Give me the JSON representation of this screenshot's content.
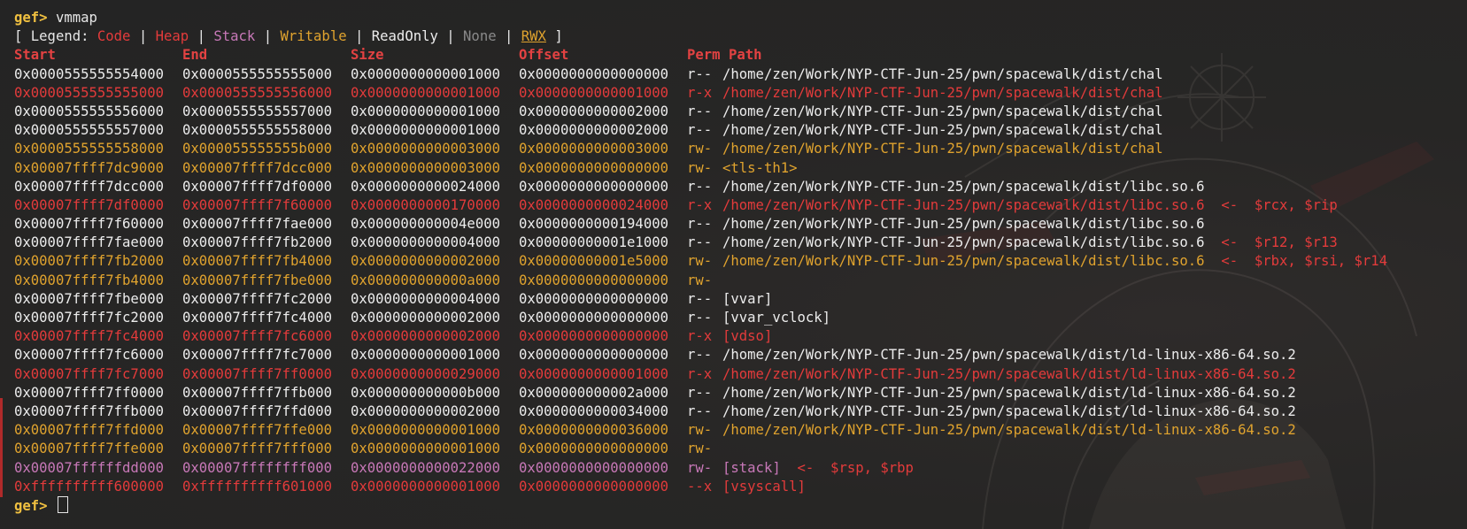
{
  "prompt": "gef>",
  "command": "vmmap",
  "legend": {
    "open": "[ Legend:",
    "close": "]",
    "separator": "|",
    "items": [
      {
        "label": "Code",
        "kind": "code"
      },
      {
        "label": "Heap",
        "kind": "heap"
      },
      {
        "label": "Stack",
        "kind": "stack"
      },
      {
        "label": "Writable",
        "kind": "write"
      },
      {
        "label": "ReadOnly",
        "kind": "ro"
      },
      {
        "label": "None",
        "kind": "none"
      },
      {
        "label": "RWX",
        "kind": "rwx"
      }
    ]
  },
  "columns": {
    "start": "Start",
    "end": "End",
    "size": "Size",
    "offset": "Offset",
    "perm_path": "Perm Path"
  },
  "rows": [
    {
      "start": "0x0000555555554000",
      "end": "0x0000555555555000",
      "size": "0x0000000000001000",
      "offset": "0x0000000000000000",
      "perm": "r--",
      "path": "/home/zen/Work/NYP-CTF-Jun-25/pwn/spacewalk/dist/chal",
      "regs": "",
      "kind": "ro"
    },
    {
      "start": "0x0000555555555000",
      "end": "0x0000555555556000",
      "size": "0x0000000000001000",
      "offset": "0x0000000000001000",
      "perm": "r-x",
      "path": "/home/zen/Work/NYP-CTF-Jun-25/pwn/spacewalk/dist/chal",
      "regs": "",
      "kind": "code"
    },
    {
      "start": "0x0000555555556000",
      "end": "0x0000555555557000",
      "size": "0x0000000000001000",
      "offset": "0x0000000000002000",
      "perm": "r--",
      "path": "/home/zen/Work/NYP-CTF-Jun-25/pwn/spacewalk/dist/chal",
      "regs": "",
      "kind": "ro"
    },
    {
      "start": "0x0000555555557000",
      "end": "0x0000555555558000",
      "size": "0x0000000000001000",
      "offset": "0x0000000000002000",
      "perm": "r--",
      "path": "/home/zen/Work/NYP-CTF-Jun-25/pwn/spacewalk/dist/chal",
      "regs": "",
      "kind": "ro"
    },
    {
      "start": "0x0000555555558000",
      "end": "0x000055555555b000",
      "size": "0x0000000000003000",
      "offset": "0x0000000000003000",
      "perm": "rw-",
      "path": "/home/zen/Work/NYP-CTF-Jun-25/pwn/spacewalk/dist/chal",
      "regs": "",
      "kind": "write"
    },
    {
      "start": "0x00007ffff7dc9000",
      "end": "0x00007ffff7dcc000",
      "size": "0x0000000000003000",
      "offset": "0x0000000000000000",
      "perm": "rw-",
      "path": "<tls-th1>",
      "regs": "",
      "kind": "write"
    },
    {
      "start": "0x00007ffff7dcc000",
      "end": "0x00007ffff7df0000",
      "size": "0x0000000000024000",
      "offset": "0x0000000000000000",
      "perm": "r--",
      "path": "/home/zen/Work/NYP-CTF-Jun-25/pwn/spacewalk/dist/libc.so.6",
      "regs": "",
      "kind": "ro"
    },
    {
      "start": "0x00007ffff7df0000",
      "end": "0x00007ffff7f60000",
      "size": "0x0000000000170000",
      "offset": "0x0000000000024000",
      "perm": "r-x",
      "path": "/home/zen/Work/NYP-CTF-Jun-25/pwn/spacewalk/dist/libc.so.6",
      "regs": "<-  $rcx, $rip",
      "kind": "code"
    },
    {
      "start": "0x00007ffff7f60000",
      "end": "0x00007ffff7fae000",
      "size": "0x000000000004e000",
      "offset": "0x0000000000194000",
      "perm": "r--",
      "path": "/home/zen/Work/NYP-CTF-Jun-25/pwn/spacewalk/dist/libc.so.6",
      "regs": "",
      "kind": "ro"
    },
    {
      "start": "0x00007ffff7fae000",
      "end": "0x00007ffff7fb2000",
      "size": "0x0000000000004000",
      "offset": "0x00000000001e1000",
      "perm": "r--",
      "path": "/home/zen/Work/NYP-CTF-Jun-25/pwn/spacewalk/dist/libc.so.6",
      "regs": "<-  $r12, $r13",
      "kind": "ro"
    },
    {
      "start": "0x00007ffff7fb2000",
      "end": "0x00007ffff7fb4000",
      "size": "0x0000000000002000",
      "offset": "0x00000000001e5000",
      "perm": "rw-",
      "path": "/home/zen/Work/NYP-CTF-Jun-25/pwn/spacewalk/dist/libc.so.6",
      "regs": "<-  $rbx, $rsi, $r14",
      "kind": "write"
    },
    {
      "start": "0x00007ffff7fb4000",
      "end": "0x00007ffff7fbe000",
      "size": "0x000000000000a000",
      "offset": "0x0000000000000000",
      "perm": "rw-",
      "path": "",
      "regs": "",
      "kind": "write"
    },
    {
      "start": "0x00007ffff7fbe000",
      "end": "0x00007ffff7fc2000",
      "size": "0x0000000000004000",
      "offset": "0x0000000000000000",
      "perm": "r--",
      "path": "[vvar]",
      "regs": "",
      "kind": "ro"
    },
    {
      "start": "0x00007ffff7fc2000",
      "end": "0x00007ffff7fc4000",
      "size": "0x0000000000002000",
      "offset": "0x0000000000000000",
      "perm": "r--",
      "path": "[vvar_vclock]",
      "regs": "",
      "kind": "ro"
    },
    {
      "start": "0x00007ffff7fc4000",
      "end": "0x00007ffff7fc6000",
      "size": "0x0000000000002000",
      "offset": "0x0000000000000000",
      "perm": "r-x",
      "path": "[vdso]",
      "regs": "",
      "kind": "code"
    },
    {
      "start": "0x00007ffff7fc6000",
      "end": "0x00007ffff7fc7000",
      "size": "0x0000000000001000",
      "offset": "0x0000000000000000",
      "perm": "r--",
      "path": "/home/zen/Work/NYP-CTF-Jun-25/pwn/spacewalk/dist/ld-linux-x86-64.so.2",
      "regs": "",
      "kind": "ro"
    },
    {
      "start": "0x00007ffff7fc7000",
      "end": "0x00007ffff7ff0000",
      "size": "0x0000000000029000",
      "offset": "0x0000000000001000",
      "perm": "r-x",
      "path": "/home/zen/Work/NYP-CTF-Jun-25/pwn/spacewalk/dist/ld-linux-x86-64.so.2",
      "regs": "",
      "kind": "code"
    },
    {
      "start": "0x00007ffff7ff0000",
      "end": "0x00007ffff7ffb000",
      "size": "0x000000000000b000",
      "offset": "0x000000000002a000",
      "perm": "r--",
      "path": "/home/zen/Work/NYP-CTF-Jun-25/pwn/spacewalk/dist/ld-linux-x86-64.so.2",
      "regs": "",
      "kind": "ro"
    },
    {
      "start": "0x00007ffff7ffb000",
      "end": "0x00007ffff7ffd000",
      "size": "0x0000000000002000",
      "offset": "0x0000000000034000",
      "perm": "r--",
      "path": "/home/zen/Work/NYP-CTF-Jun-25/pwn/spacewalk/dist/ld-linux-x86-64.so.2",
      "regs": "",
      "kind": "ro"
    },
    {
      "start": "0x00007ffff7ffd000",
      "end": "0x00007ffff7ffe000",
      "size": "0x0000000000001000",
      "offset": "0x0000000000036000",
      "perm": "rw-",
      "path": "/home/zen/Work/NYP-CTF-Jun-25/pwn/spacewalk/dist/ld-linux-x86-64.so.2",
      "regs": "",
      "kind": "write"
    },
    {
      "start": "0x00007ffff7ffe000",
      "end": "0x00007ffff7fff000",
      "size": "0x0000000000001000",
      "offset": "0x0000000000000000",
      "perm": "rw-",
      "path": "",
      "regs": "",
      "kind": "write"
    },
    {
      "start": "0x00007ffffffdd000",
      "end": "0x00007ffffffff000",
      "size": "0x0000000000022000",
      "offset": "0x0000000000000000",
      "perm": "rw-",
      "path": "[stack]",
      "regs": "<-  $rsp, $rbp",
      "kind": "stack"
    },
    {
      "start": "0xffffffffff600000",
      "end": "0xffffffffff601000",
      "size": "0x0000000000001000",
      "offset": "0x0000000000000000",
      "perm": "--x",
      "path": "[vsyscall]",
      "regs": "",
      "kind": "code"
    }
  ],
  "final_prompt": "gef>",
  "colors": {
    "background": "#262626",
    "prompt": "#f0c040",
    "readonly": "#ececec",
    "code": "#e33b3b",
    "writable": "#e0a32e",
    "stack": "#c878b8",
    "none": "#8a8a8a",
    "register_marker": "#e33b3b"
  }
}
